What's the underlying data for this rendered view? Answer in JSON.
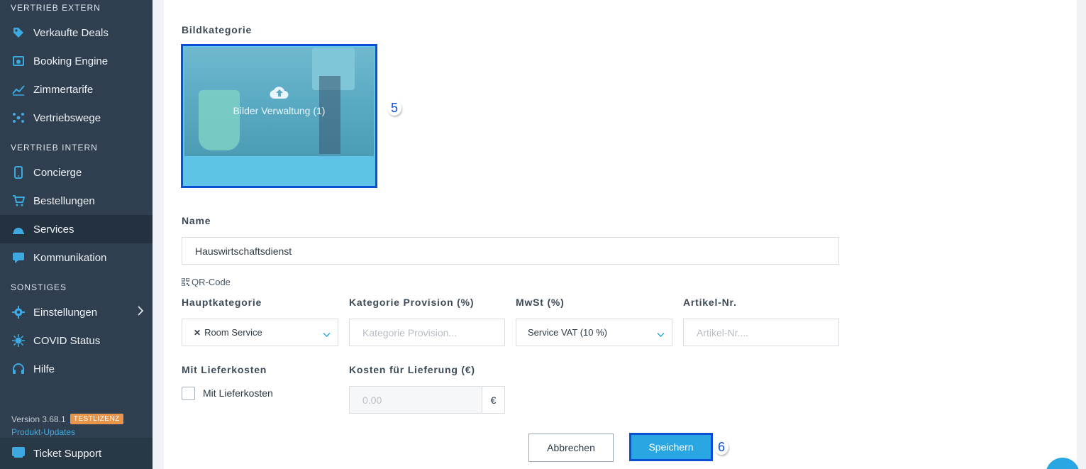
{
  "sidebar": {
    "sections": {
      "extern": "VERTRIEB EXTERN",
      "intern": "VERTRIEB INTERN",
      "sonstiges": "SONSTIGES"
    },
    "items": {
      "verkaufte_deals": "Verkaufte Deals",
      "booking_engine": "Booking Engine",
      "zimmertarife": "Zimmertarife",
      "vertriebswege": "Vertriebswege",
      "concierge": "Concierge",
      "bestellungen": "Bestellungen",
      "services": "Services",
      "kommunikation": "Kommunikation",
      "einstellungen": "Einstellungen",
      "covid_status": "COVID Status",
      "hilfe": "Hilfe"
    },
    "active_item": "Services",
    "version": "Version 3.68.1",
    "license_badge": "TESTLIZENZ",
    "updates_link": "Produkt-Updates",
    "ticket_support": "Ticket Support",
    "accent_color": "#2aa7e3"
  },
  "form": {
    "bildkategorie_label": "Bildkategorie",
    "image_overlay_text": "Bilder Verwaltung (1)",
    "callout_image": "5",
    "name_label": "Name",
    "name_value": "Hauswirtschaftsdienst",
    "qr_code_label": "QR-Code",
    "hauptkategorie_label": "Hauptkategorie",
    "hauptkategorie_value": "Room Service",
    "provision_label": "Kategorie Provision (%)",
    "provision_placeholder": "Kategorie Provision...",
    "mwst_label": "MwSt (%)",
    "mwst_value": "Service VAT (10 %)",
    "artikel_label": "Artikel-Nr.",
    "artikel_placeholder": "Artikel-Nr....",
    "lieferkosten_label": "Mit Lieferkosten",
    "lieferkosten_checkbox_label": "Mit Lieferkosten",
    "lieferkosten_checked": false,
    "kosten_label": "Kosten für Lieferung (€)",
    "kosten_placeholder": "0.00",
    "currency_symbol": "€",
    "cancel_button": "Abbrechen",
    "save_button": "Speichern",
    "callout_save": "6"
  }
}
